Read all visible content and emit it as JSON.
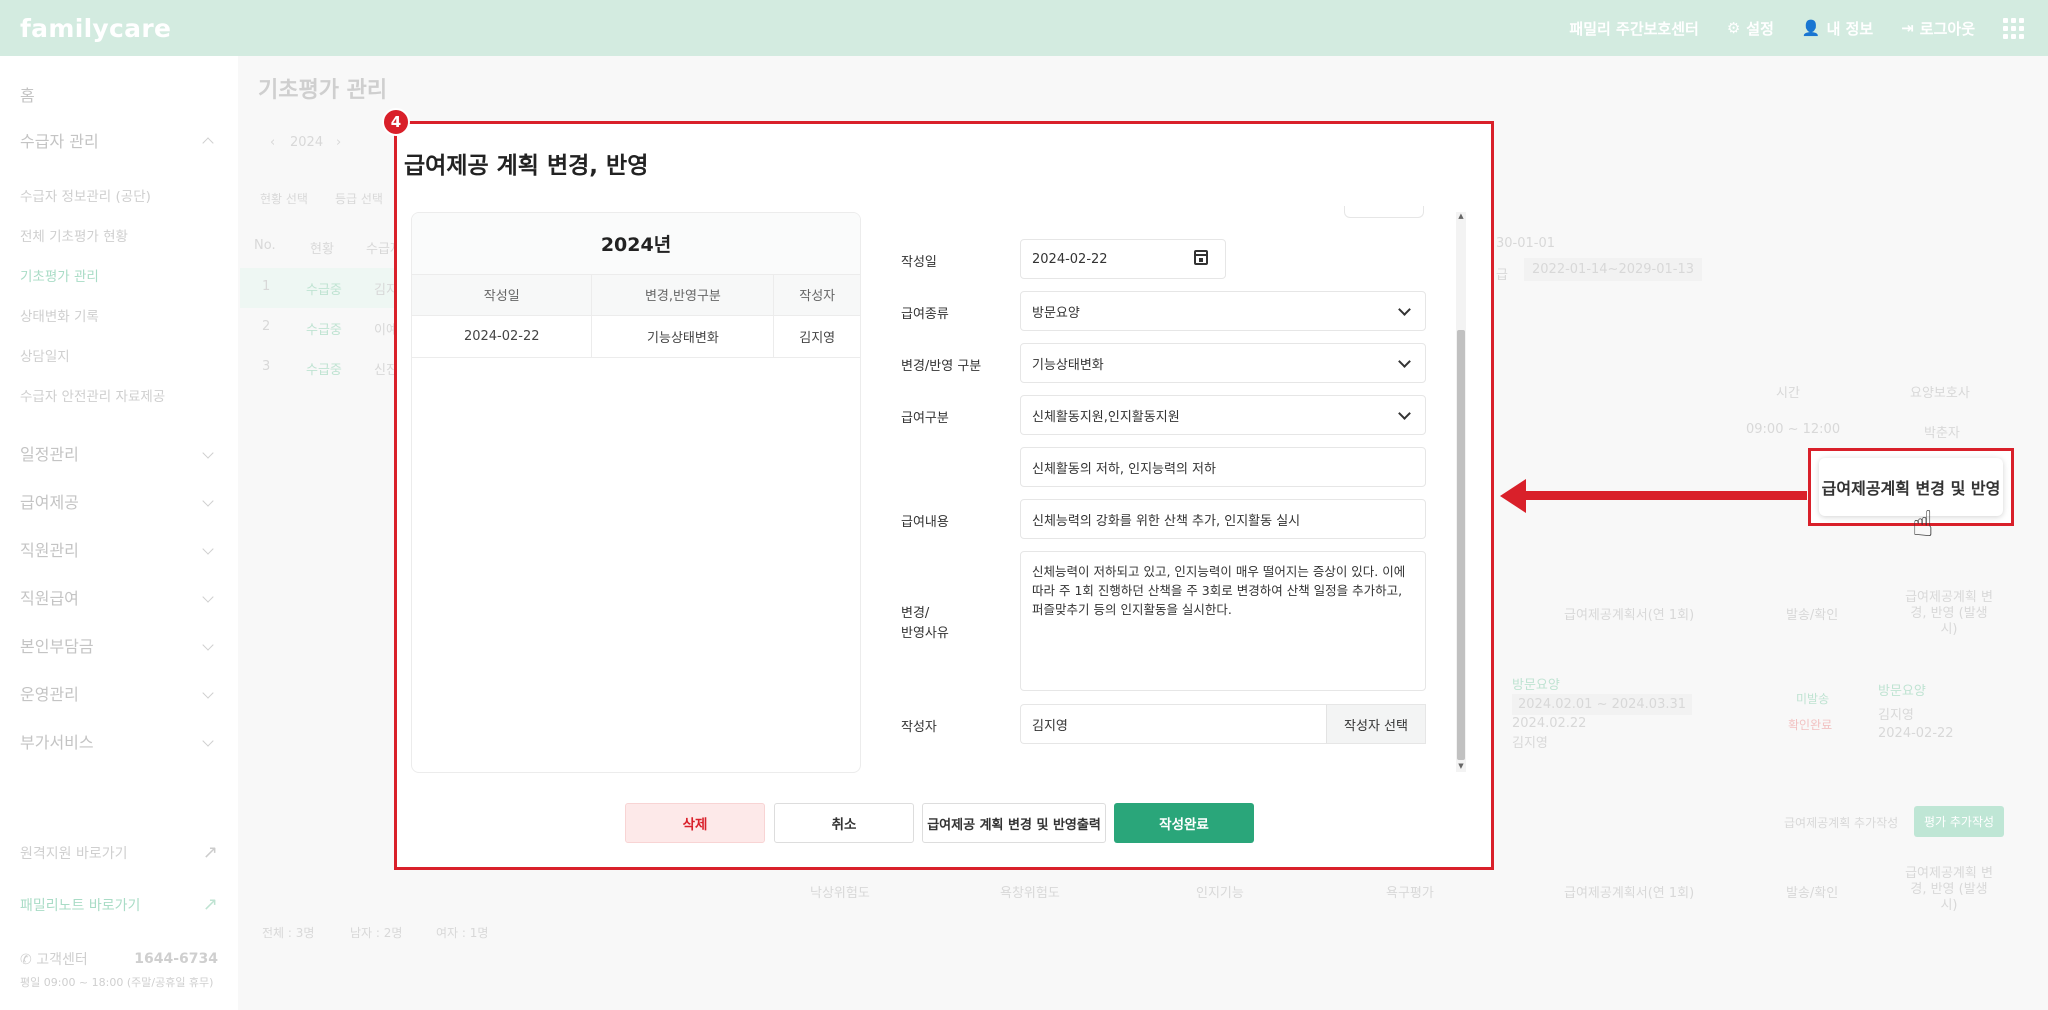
{
  "header": {
    "brand": "familycare",
    "center_name": "패밀리 주간보호센터",
    "settings": "설정",
    "my_info": "내 정보",
    "logout": "로그아웃"
  },
  "sidebar": {
    "home": "홈",
    "recipient_mgmt": "수급자 관리",
    "sub_items": [
      "수급자 정보관리 (공단)",
      "전체 기초평가 현황",
      "기초평가 관리",
      "상태변화 기록",
      "상담일지",
      "수급자 안전관리 자료제공"
    ],
    "groups": [
      "일정관리",
      "급여제공",
      "직원관리",
      "직원급여",
      "본인부담금",
      "운영관리",
      "부가서비스"
    ],
    "remote": "원격지원 바로가기",
    "familynote": "패밀리노트 바로가기",
    "support_label": "고객센터",
    "support_phone": "1644-6734",
    "support_hours": "평일 09:00 ~ 18:00 (주말/공휴일 휴무)"
  },
  "background": {
    "page_title": "기초평가 관리",
    "year": "2024",
    "filter1": "현황 선택",
    "filter2": "등급 선택",
    "col_no": "No.",
    "col_status": "현황",
    "col_name": "수급자",
    "rows": [
      {
        "no": "1",
        "status": "수급중",
        "name": "김지"
      },
      {
        "no": "2",
        "status": "수급중",
        "name": "이예"
      },
      {
        "no": "3",
        "status": "수급중",
        "name": "신진"
      }
    ],
    "date_partial": "30-01-01",
    "grade_label": "급",
    "grade_period": "2022-01-14~2029-01-13",
    "col_time": "시간",
    "col_caregiver": "요양보호사",
    "time_value": "09:00 ~ 12:00",
    "caregiver_value": "박춘자",
    "plan_header": "급여제공계획서(연 1회)",
    "send_header": "발송/확인",
    "change_header": "급여제공계획 변경, 반영 (발생시)",
    "plan_type": "방문요양",
    "plan_period": "2024.02.01 ~ 2024.03.31",
    "plan_date": "2024.02.22",
    "plan_writer": "김지영",
    "send_status": "미발송",
    "confirm_status": "확인완료",
    "change_type": "방문요양",
    "change_writer": "김지영",
    "change_date": "2024-02-22",
    "add_plan": "급여제공계획 추가작성",
    "add_eval": "평가 추가작성",
    "col_fall": "낙상위험도",
    "col_bedsore": "욕창위험도",
    "col_cognitive": "인지기능",
    "col_needs": "욕구평가",
    "summary_total": "전체 : 3명",
    "summary_male": "남자 : 2명",
    "summary_female": "여자 : 1명"
  },
  "annotation": {
    "badge": "4",
    "callout_button": "급여제공계획 변경 및 반영"
  },
  "modal": {
    "title": "급여제공 계획 변경, 반영",
    "year_label": "2024년",
    "table_headers": [
      "작성일",
      "변경,반영구분",
      "작성자"
    ],
    "table_rows": [
      [
        "2024-02-22",
        "기능상태변화",
        "김지영"
      ]
    ],
    "fields": {
      "date_label": "작성일",
      "date_value": "2024-02-22",
      "benefit_type_label": "급여종류",
      "benefit_type_value": "방문요양",
      "change_type_label": "변경/반영 구분",
      "change_type_value": "기능상태변화",
      "benefit_category_label": "급여구분",
      "benefit_category_value": "신체활동지원,인지활동지원",
      "problem_value": "신체활동의 저하, 인지능력의 저하",
      "content_label": "급여내용",
      "content_value": "신체능력의 강화를 위한 산책 추가, 인지활동 실시",
      "reason_label_1": "변경/",
      "reason_label_2": "반영사유",
      "reason_value": "신체능력이 저하되고 있고, 인지능력이 매우 떨어지는 증상이 있다. 이에 따라 주 1회 진행하던 산책을 주 3회로 변경하여 산책 일정을 추가하고, 퍼즐맞추기 등의 인지활동을 실시한다.",
      "writer_label": "작성자",
      "writer_value": "김지영",
      "writer_select": "작성자 선택"
    },
    "buttons": {
      "delete": "삭제",
      "cancel": "취소",
      "print": "급여제공 계획 변경 및 반영출력",
      "complete": "작성완료"
    }
  },
  "colors": {
    "topbar": "#d3ebe0",
    "accent_green": "#2aa67a",
    "annotation_red": "#d9202a"
  }
}
